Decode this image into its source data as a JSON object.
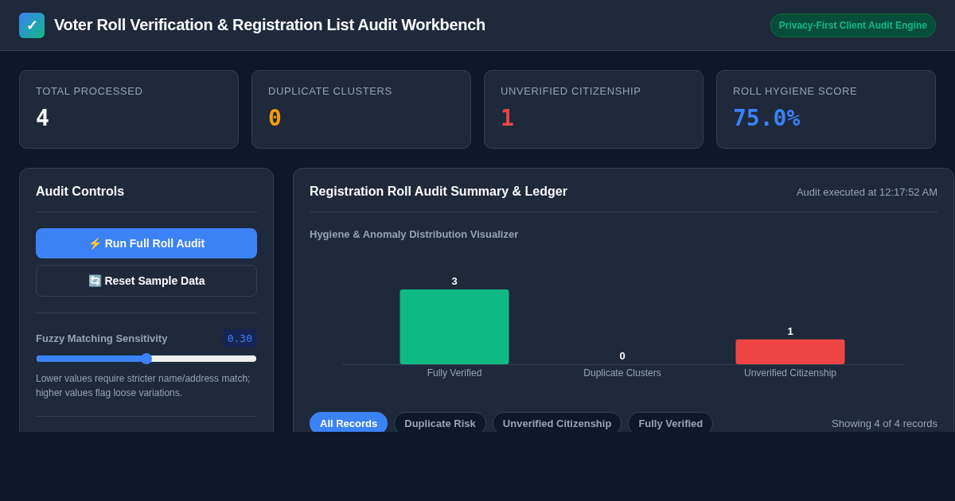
{
  "header": {
    "logo": "✓",
    "title": "Voter Roll Verification & Registration List Audit Workbench",
    "badge": "Privacy-First Client Audit Engine"
  },
  "stats": [
    {
      "label": "TOTAL PROCESSED",
      "value": "4",
      "color": "#f8fafc"
    },
    {
      "label": "DUPLICATE CLUSTERS",
      "value": "0",
      "color": "#f59e0b"
    },
    {
      "label": "UNVERIFIED CITIZENSHIP",
      "value": "1",
      "color": "#ef4444"
    },
    {
      "label": "ROLL HYGIENE SCORE",
      "value": "75.0%",
      "color": "#3b82f6"
    }
  ],
  "controls": {
    "title": "Audit Controls",
    "buttons": [
      {
        "label": "⚡ Run Full Roll Audit",
        "kind": "primary"
      },
      {
        "label": "🔄 Reset Sample Data",
        "kind": "secondary"
      }
    ],
    "slider": {
      "label": "Fuzzy Matching Sensitivity",
      "reading": "0.30",
      "level": 0.5,
      "hint": "Lower values require stricter name/address match; higher values flag loose variations."
    }
  },
  "summary": {
    "title": "Registration Roll Audit Summary & Ledger",
    "timestamp": "Audit executed at 12:17:52 AM",
    "chart_title": "Hygiene & Anomaly Distribution Visualizer",
    "chart_data": {
      "type": "bar",
      "categories": [
        "Fully Verified",
        "Duplicate Clusters",
        "Unverified Citizenship"
      ],
      "data_labels": true,
      "ylim": [
        0,
        3
      ],
      "series": [
        {
          "color": "#10b981",
          "values": [
            3,
            null,
            null
          ]
        },
        {
          "color": "#f59e0b",
          "values": [
            null,
            0,
            null
          ]
        },
        {
          "color": "#ef4444",
          "values": [
            null,
            null,
            1
          ]
        }
      ]
    },
    "filters": [
      {
        "label": "All Records",
        "selected": true
      },
      {
        "label": "Duplicate Risk",
        "selected": false
      },
      {
        "label": "Unverified Citizenship",
        "selected": false
      },
      {
        "label": "Fully Verified",
        "selected": false
      }
    ],
    "count": "Showing 4 of 4 records"
  }
}
